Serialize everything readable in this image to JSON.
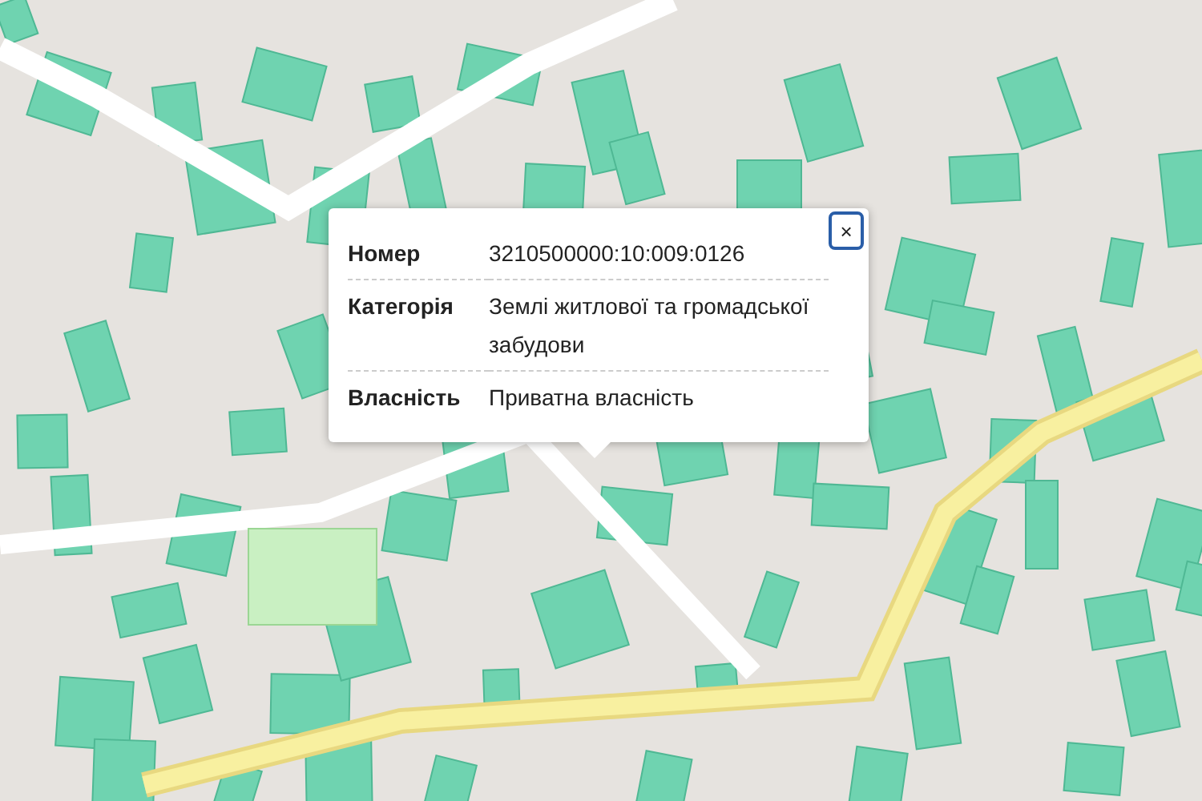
{
  "popup": {
    "close": "×",
    "rows": [
      {
        "label": "Номер",
        "value": "3210500000:10:009:0126"
      },
      {
        "label": "Категорія",
        "value": "Землі житлової та громадської забудови"
      },
      {
        "label": "Власність",
        "value": "Приватна власність"
      }
    ]
  }
}
